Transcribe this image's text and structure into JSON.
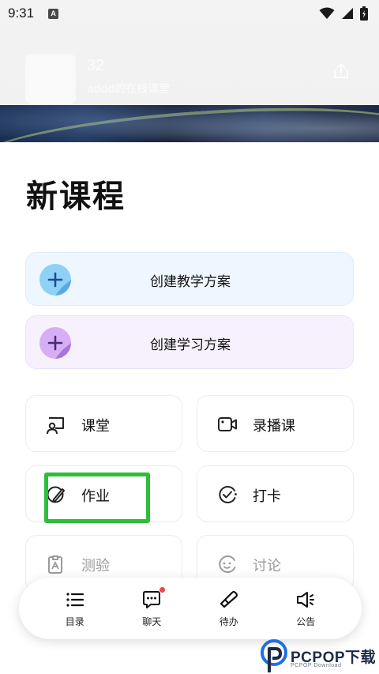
{
  "status_bar": {
    "time": "9:31",
    "notification_glyph": "A"
  },
  "header": {
    "course_code": "32",
    "course_subtitle": "addd的在线课堂"
  },
  "page": {
    "title": "新课程"
  },
  "plans": [
    {
      "label": "创建教学方案",
      "icon": "plus-sticker-icon",
      "color": "#7cc4f2"
    },
    {
      "label": "创建学习方案",
      "icon": "plus-sticker-icon",
      "color": "#c89af0"
    }
  ],
  "tiles": [
    {
      "label": "课堂",
      "icon": "classroom-icon",
      "enabled": true
    },
    {
      "label": "录播课",
      "icon": "video-camera-icon",
      "enabled": true
    },
    {
      "label": "作业",
      "icon": "homework-pen-icon",
      "enabled": true
    },
    {
      "label": "打卡",
      "icon": "check-in-icon",
      "enabled": true
    },
    {
      "label": "测验",
      "icon": "quiz-icon",
      "enabled": false
    },
    {
      "label": "讨论",
      "icon": "discussion-icon",
      "enabled": false
    }
  ],
  "bottom_nav": [
    {
      "label": "目录",
      "icon": "list-icon"
    },
    {
      "label": "聊天",
      "icon": "chat-icon",
      "badge_dot": true
    },
    {
      "label": "待办",
      "icon": "todo-icon"
    },
    {
      "label": "公告",
      "icon": "announcement-icon"
    }
  ],
  "watermark": {
    "brand": "PCPOP下载",
    "sub": "PCPOP Download"
  },
  "colors": {
    "highlight_box": "#2ebd3a",
    "badge": "#f14444",
    "teach_plan_bg": "#eef6ff",
    "learn_plan_bg": "#f7f1fe"
  }
}
